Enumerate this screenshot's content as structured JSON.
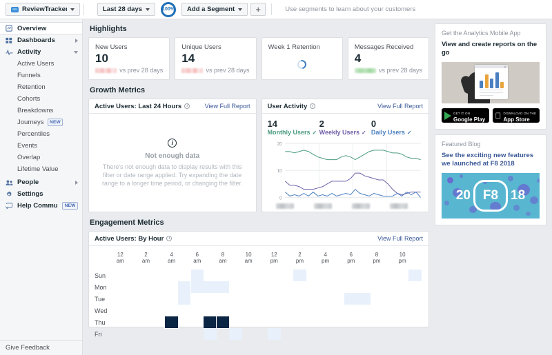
{
  "topbar": {
    "account": "ReviewTrackers",
    "date_range": "Last 28 days",
    "percent": "100%",
    "segment": "Add a Segment",
    "add_button": "+",
    "segment_hint": "Use segments to learn about your customers"
  },
  "sidebar": {
    "items": [
      {
        "label": "Overview",
        "icon": "overview-icon",
        "active": true,
        "arrow": "none"
      },
      {
        "label": "Dashboards",
        "icon": "grid-icon",
        "active": false,
        "arrow": "right"
      },
      {
        "label": "Activity",
        "icon": "pulse-icon",
        "active": false,
        "arrow": "down"
      }
    ],
    "activity_children": [
      {
        "label": "Active Users",
        "badge": ""
      },
      {
        "label": "Funnels",
        "badge": ""
      },
      {
        "label": "Retention",
        "badge": ""
      },
      {
        "label": "Cohorts",
        "badge": ""
      },
      {
        "label": "Breakdowns",
        "badge": ""
      },
      {
        "label": "Journeys",
        "badge": "NEW"
      },
      {
        "label": "Percentiles",
        "badge": ""
      },
      {
        "label": "Events",
        "badge": ""
      },
      {
        "label": "Overlap",
        "badge": ""
      },
      {
        "label": "Lifetime Value",
        "badge": ""
      }
    ],
    "bottom_items": [
      {
        "label": "People",
        "icon": "people-icon",
        "arrow": "right",
        "badge": ""
      },
      {
        "label": "Settings",
        "icon": "gear-icon",
        "arrow": "none",
        "badge": ""
      },
      {
        "label": "Help Community",
        "icon": "chat-icon",
        "arrow": "none",
        "badge": "NEW"
      }
    ],
    "feedback": "Give Feedback"
  },
  "main": {
    "highlights_title": "Highlights",
    "highlight_cards": [
      {
        "title": "New Users",
        "value": "10",
        "compare": "vs prev 28 days",
        "bar": "red",
        "loading": false
      },
      {
        "title": "Unique Users",
        "value": "14",
        "compare": "vs prev 28 days",
        "bar": "red",
        "loading": false
      },
      {
        "title": "Week 1 Retention",
        "value": "",
        "compare": "",
        "bar": "none",
        "loading": true
      },
      {
        "title": "Messages Received",
        "value": "4",
        "compare": "vs prev 28 days",
        "bar": "green",
        "loading": false
      }
    ],
    "growth_title": "Growth Metrics",
    "active_users_24h": {
      "title": "Active Users: Last 24 Hours",
      "view_link": "View Full Report",
      "empty_heading": "Not enough data",
      "empty_body": "There's not enough data to display results with this filter or date range applied. Try expanding the date range to a longer time period, or changing the filter."
    },
    "user_activity": {
      "title": "User Activity",
      "view_link": "View Full Report",
      "stats": [
        {
          "value": "14",
          "label": "Monthly Users",
          "color": "#4a9b7f"
        },
        {
          "value": "2",
          "label": "Weekly Users",
          "color": "#6f5ea8"
        },
        {
          "value": "0",
          "label": "Daily Users",
          "color": "#4a7fc1"
        }
      ]
    },
    "engagement_title": "Engagement Metrics",
    "active_users_by_hour": {
      "title": "Active Users: By Hour",
      "view_link": "View Full Report"
    }
  },
  "rail": {
    "mobile_app": {
      "kicker": "Get the Analytics Mobile App",
      "headline": "View and create reports on the go",
      "google_small": "GET IT ON",
      "google_big": "Google Play",
      "apple_small": "Download on the",
      "apple_big": "App Store"
    },
    "featured_blog": {
      "kicker": "Featured Blog",
      "headline": "See the exciting new features we launched at F8 2018",
      "art_left": "20",
      "art_center": "F8",
      "art_right": "18"
    }
  },
  "chart_data": [
    {
      "type": "line",
      "title": "User Activity",
      "xlabel": "",
      "ylabel": "",
      "ylim": [
        0,
        20
      ],
      "yticks": [
        0,
        10,
        20
      ],
      "grid": true,
      "legend_position": "top",
      "xtick_labels_blurred": true,
      "series": [
        {
          "name": "Monthly Users",
          "color": "#4a9b7f",
          "current": 14,
          "values": [
            17,
            17,
            16.5,
            17,
            17.5,
            17,
            16,
            15,
            14.5,
            14,
            14,
            14,
            15,
            15.5,
            15,
            14,
            15,
            16,
            17,
            17.5,
            17.5,
            17.5,
            17,
            16.5,
            16.5,
            16,
            15,
            14.5,
            14.5,
            14
          ]
        },
        {
          "name": "Weekly Users",
          "color": "#6f5ea8",
          "current": 2,
          "values": [
            6,
            4.5,
            4.5,
            4,
            3,
            3,
            3,
            3.5,
            4,
            5,
            6,
            6,
            6,
            6,
            7,
            9,
            9,
            8,
            7.5,
            7,
            6.5,
            6.5,
            5,
            3,
            1.5,
            1,
            1.5,
            2,
            2,
            2
          ]
        },
        {
          "name": "Daily Users",
          "color": "#4a7fc1",
          "current": 0,
          "values": [
            2,
            0.5,
            1,
            0.5,
            1.5,
            0.5,
            2,
            0.5,
            1,
            0.5,
            1.5,
            0.5,
            1,
            1.5,
            1,
            3,
            1.5,
            1,
            0.5,
            1.5,
            1,
            0.5,
            0.5,
            0.5,
            1.5,
            0.5,
            2,
            1,
            2,
            0
          ]
        }
      ]
    },
    {
      "type": "heatmap",
      "title": "Active Users: By Hour",
      "xlabel": "",
      "ylabel": "",
      "columns": [
        "12 am",
        "1 am",
        "2 am",
        "3 am",
        "4 am",
        "5 am",
        "6 am",
        "7 am",
        "8 am",
        "9 am",
        "10 am",
        "11 am",
        "12 pm",
        "1 pm",
        "2 pm",
        "3 pm",
        "4 pm",
        "5 pm",
        "6 pm",
        "7 pm",
        "8 pm",
        "9 pm",
        "10 pm",
        "11 pm"
      ],
      "column_labels_shown": [
        "12 am",
        "2 am",
        "4 am",
        "6 am",
        "8 am",
        "10 am",
        "12 pm",
        "2 pm",
        "4 pm",
        "6 pm",
        "8 pm",
        "10 pm"
      ],
      "rows": [
        "Sun",
        "Mon",
        "Tue",
        "Wed",
        "Thu",
        "Fri"
      ],
      "colorscale": {
        "min": "#ffffff",
        "max": "#0b2545"
      },
      "cells": [
        {
          "row": "Sun",
          "col": "6 am",
          "value": 1
        },
        {
          "row": "Sun",
          "col": "2 pm",
          "value": 1
        },
        {
          "row": "Sun",
          "col": "11 pm",
          "value": 1
        },
        {
          "row": "Mon",
          "col": "5 am",
          "value": 1
        },
        {
          "row": "Mon",
          "col": "6 am",
          "value": 1
        },
        {
          "row": "Mon",
          "col": "7 am",
          "value": 1
        },
        {
          "row": "Mon",
          "col": "8 am",
          "value": 1
        },
        {
          "row": "Tue",
          "col": "5 am",
          "value": 1
        },
        {
          "row": "Tue",
          "col": "6 pm",
          "value": 1
        },
        {
          "row": "Tue",
          "col": "7 pm",
          "value": 1
        },
        {
          "row": "Thu",
          "col": "4 am",
          "value": 5
        },
        {
          "row": "Thu",
          "col": "7 am",
          "value": 5
        },
        {
          "row": "Thu",
          "col": "8 am",
          "value": 5
        },
        {
          "row": "Fri",
          "col": "7 am",
          "value": 1
        },
        {
          "row": "Fri",
          "col": "9 am",
          "value": 1
        },
        {
          "row": "Fri",
          "col": "12 pm",
          "value": 1
        }
      ]
    }
  ]
}
